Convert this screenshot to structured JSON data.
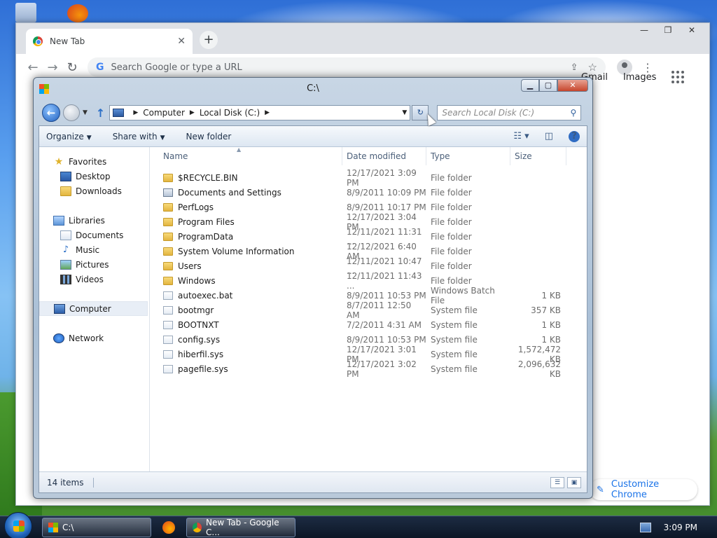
{
  "chrome": {
    "tab_title": "New Tab",
    "tab_close": "✕",
    "new_tab": "+",
    "window_controls": [
      "—",
      "❐",
      "✕"
    ],
    "omnibox_placeholder": "Search Google or type a URL",
    "google_links": [
      "Gmail",
      "Images"
    ],
    "customize_label": "Customize Chrome"
  },
  "explorer": {
    "title": "C:\\",
    "breadcrumb": [
      "Computer",
      "Local Disk (C:)"
    ],
    "search_placeholder": "Search Local Disk (C:)",
    "commands": [
      "Organize",
      "Share with",
      "New folder"
    ],
    "nav": {
      "favorites": {
        "label": "Favorites",
        "items": [
          "Desktop",
          "Downloads"
        ]
      },
      "libraries": {
        "label": "Libraries",
        "items": [
          "Documents",
          "Music",
          "Pictures",
          "Videos"
        ]
      },
      "computer": "Computer",
      "network": "Network"
    },
    "columns": {
      "name": "Name",
      "date": "Date modified",
      "type": "Type",
      "size": "Size"
    },
    "files": [
      {
        "name": "$RECYCLE.BIN",
        "date": "12/17/2021 3:09 PM",
        "type": "File folder",
        "size": "",
        "icon": "folder"
      },
      {
        "name": "Documents and Settings",
        "date": "8/9/2011 10:09 PM",
        "type": "File folder",
        "size": "",
        "icon": "shortcut"
      },
      {
        "name": "PerfLogs",
        "date": "8/9/2011 10:17 PM",
        "type": "File folder",
        "size": "",
        "icon": "folder"
      },
      {
        "name": "Program Files",
        "date": "12/17/2021 3:04 PM",
        "type": "File folder",
        "size": "",
        "icon": "folder"
      },
      {
        "name": "ProgramData",
        "date": "12/11/2021 11:31 ...",
        "type": "File folder",
        "size": "",
        "icon": "folder"
      },
      {
        "name": "System Volume Information",
        "date": "12/12/2021 6:40 AM",
        "type": "File folder",
        "size": "",
        "icon": "folder"
      },
      {
        "name": "Users",
        "date": "12/11/2021 10:47 ...",
        "type": "File folder",
        "size": "",
        "icon": "folder"
      },
      {
        "name": "Windows",
        "date": "12/11/2021 11:43 ...",
        "type": "File folder",
        "size": "",
        "icon": "folder"
      },
      {
        "name": "autoexec.bat",
        "date": "8/9/2011 10:53 PM",
        "type": "Windows Batch File",
        "size": "1 KB",
        "icon": "sys"
      },
      {
        "name": "bootmgr",
        "date": "8/7/2011 12:50 AM",
        "type": "System file",
        "size": "357 KB",
        "icon": "sys"
      },
      {
        "name": "BOOTNXT",
        "date": "7/2/2011 4:31 AM",
        "type": "System file",
        "size": "1 KB",
        "icon": "sys"
      },
      {
        "name": "config.sys",
        "date": "8/9/2011 10:53 PM",
        "type": "System file",
        "size": "1 KB",
        "icon": "sys"
      },
      {
        "name": "hiberfil.sys",
        "date": "12/17/2021 3:01 PM",
        "type": "System file",
        "size": "1,572,472 KB",
        "icon": "sys"
      },
      {
        "name": "pagefile.sys",
        "date": "12/17/2021 3:02 PM",
        "type": "System file",
        "size": "2,096,632 KB",
        "icon": "sys"
      }
    ],
    "status_count": "14 items"
  },
  "taskbar": {
    "explorer_label": "C:\\",
    "chrome_label": "New Tab - Google C...",
    "clock": "3:09 PM"
  },
  "colors": {
    "accent": "#1a73e8",
    "close_red": "#c7452c"
  }
}
